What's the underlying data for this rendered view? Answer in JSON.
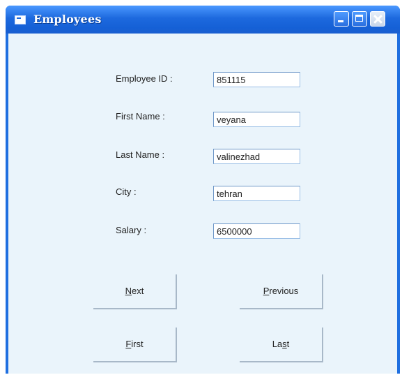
{
  "window": {
    "title": "Employees"
  },
  "titlebar": {
    "icon": "app-icon",
    "min_icon": "minimize-icon",
    "max_icon": "maximize-icon",
    "close_icon": "close-icon"
  },
  "form": {
    "employee_id": {
      "label": "Employee ID :",
      "value": "851115"
    },
    "first_name": {
      "label": "First Name :",
      "value": "veyana"
    },
    "last_name": {
      "label": "Last Name :",
      "value": "valinezhad"
    },
    "city": {
      "label": "City :",
      "value": "tehran"
    },
    "salary": {
      "label": "Salary :",
      "value": "6500000"
    }
  },
  "buttons": {
    "next": {
      "mnemonic": "N",
      "rest": "ext"
    },
    "previous": {
      "mnemonic": "P",
      "rest": "revious"
    },
    "first": {
      "mnemonic": "F",
      "rest": "irst"
    },
    "last": {
      "pre": "La",
      "mnemonic": "s",
      "rest": "t"
    }
  },
  "colors": {
    "titlebar": "#1d69de",
    "client_bg": "#eaf4fb",
    "field_border": "#9bbfe6"
  }
}
